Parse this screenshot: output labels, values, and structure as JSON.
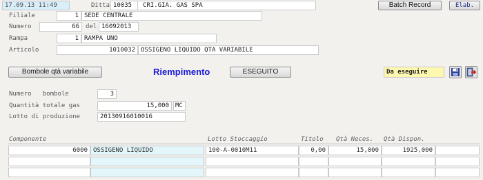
{
  "header": {
    "datetime": "17.09.13 11:49",
    "ditta_label": "Ditta",
    "ditta_code": "10035",
    "ditta_name": "CRI.GIA. GAS SPA",
    "batch_record_label": "Batch Record",
    "elab_label": "Elab."
  },
  "form": {
    "filiale_label": "Filiale",
    "filiale_code": "1",
    "filiale_name": "SEDE CENTRALE",
    "numero_label": "Numero",
    "numero_value": "66",
    "del_label": "del",
    "del_value": "16092013",
    "rampa_label": "Rampa",
    "rampa_code": "1",
    "rampa_name": "RAMPA UNO",
    "articolo_label": "Articolo",
    "articolo_code": "1010032",
    "articolo_desc": "OSSIGENO LIQUIDO QTA VARIABILE"
  },
  "actions": {
    "bombole_button": "Bombole qtà variabile",
    "title": "Riempimento",
    "eseguito_button": "ESEGUITO",
    "status": "Da eseguire",
    "colors": {
      "title": "#1a1ad6",
      "status_bg": "#fdf7b0"
    }
  },
  "details": {
    "numero_bombole_label": "Numero   bombole",
    "numero_bombole_value": "3",
    "quantita_label": "Quantità totale gas",
    "quantita_value": "15,000",
    "quantita_unit": "MC",
    "lotto_label": "Lotto di produzione",
    "lotto_value": "20130916010016"
  },
  "grid": {
    "headers": [
      "Componente",
      "Lotto Stoccaggio",
      "Titolo",
      "Qtà Neces.",
      "Qtà Dispon."
    ],
    "rows": [
      {
        "code": "6000",
        "name": "OSSIGENO LIQUIDO",
        "lotto": "100-A-0010M11",
        "titolo": "0,00",
        "neces": "15,000",
        "dispon": "1925,000"
      },
      {
        "code": "",
        "name": "",
        "lotto": "",
        "titolo": "",
        "neces": "",
        "dispon": ""
      },
      {
        "code": "",
        "name": "",
        "lotto": "",
        "titolo": "",
        "neces": "",
        "dispon": ""
      }
    ]
  }
}
